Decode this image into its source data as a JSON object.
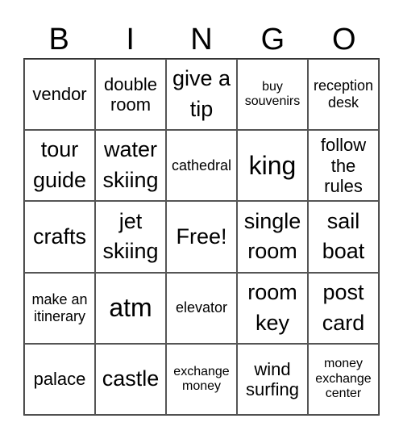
{
  "title_letters": [
    "B",
    "I",
    "N",
    "G",
    "O"
  ],
  "cells": [
    {
      "text": "vendor",
      "size": "m"
    },
    {
      "text": "double room",
      "size": "m"
    },
    {
      "text": "give a tip",
      "size": "l"
    },
    {
      "text": "buy souvenirs",
      "size": "xs"
    },
    {
      "text": "reception desk",
      "size": "s"
    },
    {
      "text": "tour guide",
      "size": "l"
    },
    {
      "text": "water skiing",
      "size": "l"
    },
    {
      "text": "cathedral",
      "size": "s"
    },
    {
      "text": "king",
      "size": "xl"
    },
    {
      "text": "follow the rules",
      "size": "m"
    },
    {
      "text": "crafts",
      "size": "l"
    },
    {
      "text": "jet skiing",
      "size": "l"
    },
    {
      "text": "Free!",
      "size": "l"
    },
    {
      "text": "single room",
      "size": "l"
    },
    {
      "text": "sail boat",
      "size": "l"
    },
    {
      "text": "make an itinerary",
      "size": "s"
    },
    {
      "text": "atm",
      "size": "xl"
    },
    {
      "text": "elevator",
      "size": "s"
    },
    {
      "text": "room key",
      "size": "l"
    },
    {
      "text": "post card",
      "size": "l"
    },
    {
      "text": "palace",
      "size": "m"
    },
    {
      "text": "castle",
      "size": "l"
    },
    {
      "text": "exchange money",
      "size": "xs"
    },
    {
      "text": "wind surfing",
      "size": "m"
    },
    {
      "text": "money exchange center",
      "size": "xs"
    }
  ]
}
